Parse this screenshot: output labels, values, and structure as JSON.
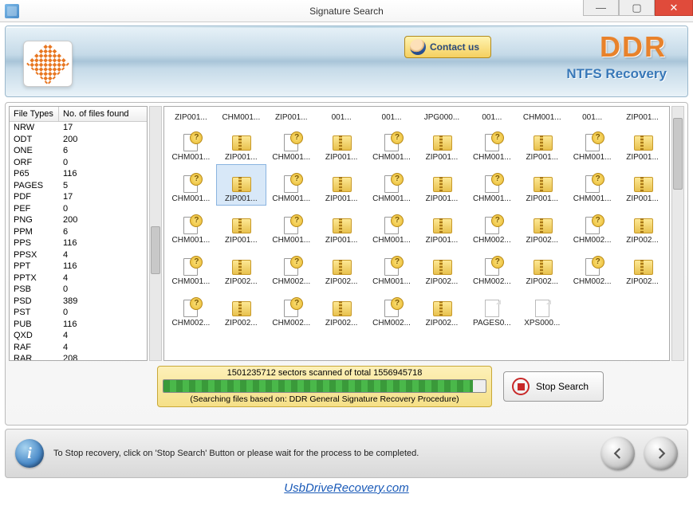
{
  "window": {
    "title": "Signature Search"
  },
  "banner": {
    "contact_label": "Contact us",
    "brand_main": "DDR",
    "brand_sub": "NTFS Recovery"
  },
  "table": {
    "col1": "File Types",
    "col2": "No. of files found",
    "rows": [
      {
        "type": "NRW",
        "count": "17"
      },
      {
        "type": "ODT",
        "count": "200"
      },
      {
        "type": "ONE",
        "count": "6"
      },
      {
        "type": "ORF",
        "count": "0"
      },
      {
        "type": "P65",
        "count": "116"
      },
      {
        "type": "PAGES",
        "count": "5"
      },
      {
        "type": "PDF",
        "count": "17"
      },
      {
        "type": "PEF",
        "count": "0"
      },
      {
        "type": "PNG",
        "count": "200"
      },
      {
        "type": "PPM",
        "count": "6"
      },
      {
        "type": "PPS",
        "count": "116"
      },
      {
        "type": "PPSX",
        "count": "4"
      },
      {
        "type": "PPT",
        "count": "116"
      },
      {
        "type": "PPTX",
        "count": "4"
      },
      {
        "type": "PSB",
        "count": "0"
      },
      {
        "type": "PSD",
        "count": "389"
      },
      {
        "type": "PST",
        "count": "0"
      },
      {
        "type": "PUB",
        "count": "116"
      },
      {
        "type": "QXD",
        "count": "4"
      },
      {
        "type": "RAF",
        "count": "4"
      },
      {
        "type": "RAR",
        "count": "208"
      }
    ]
  },
  "files": [
    {
      "n": "ZIP001...",
      "k": "top"
    },
    {
      "n": "CHM001...",
      "k": "top"
    },
    {
      "n": "ZIP001...",
      "k": "top"
    },
    {
      "n": "001...",
      "k": "top"
    },
    {
      "n": "001...",
      "k": "top"
    },
    {
      "n": "JPG000...",
      "k": "top"
    },
    {
      "n": "001...",
      "k": "top"
    },
    {
      "n": "CHM001...",
      "k": "top"
    },
    {
      "n": "001...",
      "k": "top"
    },
    {
      "n": "ZIP001...",
      "k": "top"
    },
    {
      "n": "CHM001...",
      "k": "chm"
    },
    {
      "n": "ZIP001...",
      "k": "zip"
    },
    {
      "n": "CHM001...",
      "k": "chm"
    },
    {
      "n": "ZIP001...",
      "k": "zip"
    },
    {
      "n": "CHM001...",
      "k": "chm"
    },
    {
      "n": "ZIP001...",
      "k": "zip"
    },
    {
      "n": "CHM001...",
      "k": "chm"
    },
    {
      "n": "ZIP001...",
      "k": "zip"
    },
    {
      "n": "CHM001...",
      "k": "chm"
    },
    {
      "n": "ZIP001...",
      "k": "zip"
    },
    {
      "n": "CHM001...",
      "k": "chm"
    },
    {
      "n": "ZIP001...",
      "k": "zip",
      "sel": true
    },
    {
      "n": "CHM001...",
      "k": "chm"
    },
    {
      "n": "ZIP001...",
      "k": "zip"
    },
    {
      "n": "CHM001...",
      "k": "chm"
    },
    {
      "n": "ZIP001...",
      "k": "zip"
    },
    {
      "n": "CHM001...",
      "k": "chm"
    },
    {
      "n": "ZIP001...",
      "k": "zip"
    },
    {
      "n": "CHM001...",
      "k": "chm"
    },
    {
      "n": "ZIP001...",
      "k": "zip"
    },
    {
      "n": "CHM001...",
      "k": "chm"
    },
    {
      "n": "ZIP001...",
      "k": "zip"
    },
    {
      "n": "CHM001...",
      "k": "chm"
    },
    {
      "n": "ZIP001...",
      "k": "zip"
    },
    {
      "n": "CHM001...",
      "k": "chm"
    },
    {
      "n": "ZIP001...",
      "k": "zip"
    },
    {
      "n": "CHM002...",
      "k": "chm"
    },
    {
      "n": "ZIP002...",
      "k": "zip"
    },
    {
      "n": "CHM002...",
      "k": "chm"
    },
    {
      "n": "ZIP002...",
      "k": "zip"
    },
    {
      "n": "CHM001...",
      "k": "chm"
    },
    {
      "n": "ZIP002...",
      "k": "zip"
    },
    {
      "n": "CHM002...",
      "k": "chm"
    },
    {
      "n": "ZIP002...",
      "k": "zip"
    },
    {
      "n": "CHM001...",
      "k": "chm"
    },
    {
      "n": "ZIP002...",
      "k": "zip"
    },
    {
      "n": "CHM002...",
      "k": "chm"
    },
    {
      "n": "ZIP002...",
      "k": "zip"
    },
    {
      "n": "CHM002...",
      "k": "chm"
    },
    {
      "n": "ZIP002...",
      "k": "zip"
    },
    {
      "n": "CHM002...",
      "k": "chm"
    },
    {
      "n": "ZIP002...",
      "k": "zip"
    },
    {
      "n": "CHM002...",
      "k": "chm"
    },
    {
      "n": "ZIP002...",
      "k": "zip"
    },
    {
      "n": "CHM002...",
      "k": "chm"
    },
    {
      "n": "ZIP002...",
      "k": "zip"
    },
    {
      "n": "PAGES0...",
      "k": "page"
    },
    {
      "n": "XPS000...",
      "k": "page"
    }
  ],
  "progress": {
    "sectors_text_pre": "1501235712",
    "sectors_text_mid": " sectors scanned of total ",
    "sectors_text_post": "1556945718",
    "percent": 96,
    "note": "(Searching files based on:  DDR General Signature Recovery Procedure)"
  },
  "stop_label": "Stop Search",
  "footer": {
    "message": "To Stop recovery, click on 'Stop Search' Button or please wait for the process to be completed."
  },
  "site_url": "UsbDriveRecovery.com"
}
